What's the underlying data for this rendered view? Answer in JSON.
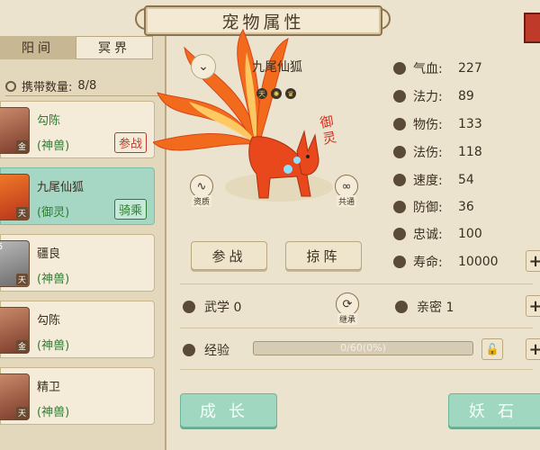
{
  "title": "宠物属性",
  "tabs": [
    {
      "label": "阳间",
      "active": true
    },
    {
      "label": "冥界",
      "active": false
    }
  ],
  "carry": {
    "label": "携带数量:",
    "value": "8/8"
  },
  "pets": [
    {
      "name": "勾陈",
      "type": "(神兽)",
      "badge": "金",
      "tag": "参战",
      "tag_color": "red",
      "selected": false
    },
    {
      "name": "九尾仙狐",
      "type": "(御灵)",
      "badge": "天",
      "tag": "骑乘",
      "tag_color": "green",
      "selected": true
    },
    {
      "name": "疆良",
      "type": "(神兽)",
      "badge": "天",
      "level": "5",
      "tag": "",
      "selected": false
    },
    {
      "name": "勾陈",
      "type": "(神兽)",
      "badge": "金",
      "tag": "",
      "selected": false
    },
    {
      "name": "精卫",
      "type": "(神兽)",
      "badge": "天",
      "tag": "",
      "selected": false
    }
  ],
  "pet": {
    "name": "九尾仙狐",
    "stamp": "御灵",
    "tag_badges": [
      "天",
      "✺",
      "♛"
    ]
  },
  "side_buttons": {
    "left": "资质",
    "right": "共通"
  },
  "action_buttons": {
    "fight": "参战",
    "lineup": "掠阵"
  },
  "stats": [
    {
      "key": "气血:",
      "value": "227",
      "icon": "heart-icon"
    },
    {
      "key": "法力:",
      "value": "89",
      "icon": "drop-icon"
    },
    {
      "key": "物伤:",
      "value": "133",
      "icon": "sword-icon"
    },
    {
      "key": "法伤:",
      "value": "118",
      "icon": "flame-icon"
    },
    {
      "key": "速度:",
      "value": "54",
      "icon": "speed-icon"
    },
    {
      "key": "防御:",
      "value": "36",
      "icon": "shield-icon"
    },
    {
      "key": "忠诚:",
      "value": "100",
      "icon": "loyalty-icon"
    },
    {
      "key": "寿命:",
      "value": "10000",
      "icon": "lock-icon"
    }
  ],
  "martial": {
    "label": "武学 0",
    "inherit": "继承"
  },
  "intimacy": {
    "label": "亲密 1"
  },
  "exp": {
    "label": "经验",
    "text": "0/60(0%)",
    "progress": 0
  },
  "bottom": {
    "grow": "成长",
    "stone": "妖石"
  }
}
